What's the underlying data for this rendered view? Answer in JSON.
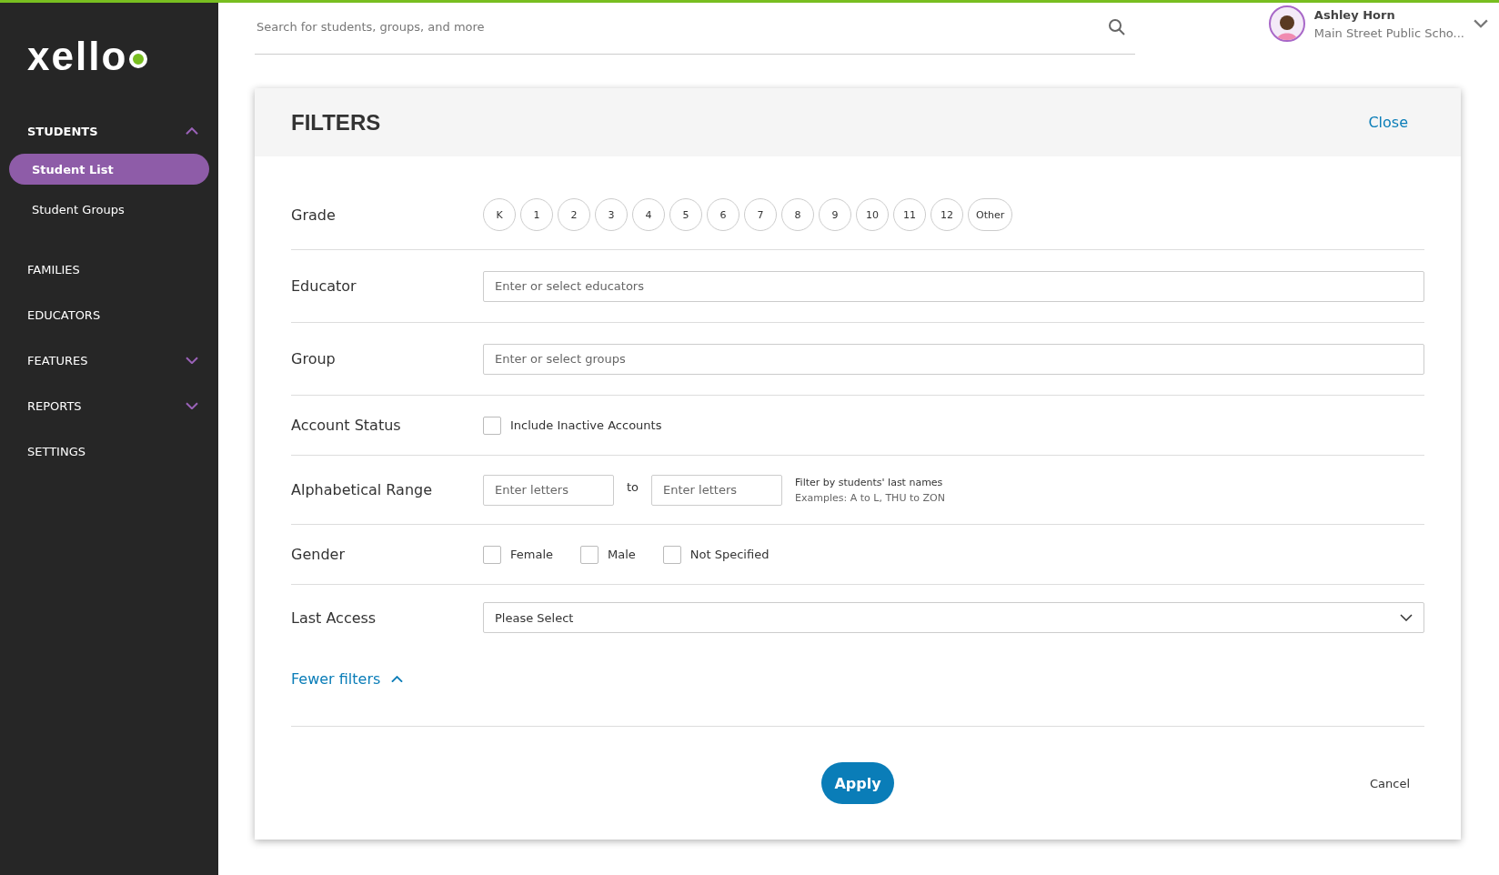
{
  "sidebar": {
    "logo": "xello",
    "items": [
      {
        "label": "STUDENTS",
        "expanded": true,
        "children": [
          {
            "label": "Student List",
            "selected": true
          },
          {
            "label": "Student Groups",
            "selected": false
          }
        ]
      },
      {
        "label": "FAMILIES"
      },
      {
        "label": "EDUCATORS"
      },
      {
        "label": "FEATURES",
        "expanded": false
      },
      {
        "label": "REPORTS",
        "expanded": false
      },
      {
        "label": "SETTINGS"
      }
    ]
  },
  "search": {
    "placeholder": "Search for students, groups, and more"
  },
  "user": {
    "name": "Ashley Horn",
    "school": "Main Street Public Scho..."
  },
  "filters": {
    "title": "FILTERS",
    "close": "Close",
    "grade": {
      "label": "Grade",
      "options": [
        {
          "label": "K",
          "selected": false
        },
        {
          "label": "1",
          "selected": false
        },
        {
          "label": "2",
          "selected": false
        },
        {
          "label": "3",
          "selected": false
        },
        {
          "label": "4",
          "selected": false
        },
        {
          "label": "5",
          "selected": false
        },
        {
          "label": "6",
          "selected": false
        },
        {
          "label": "7",
          "selected": false
        },
        {
          "label": "8",
          "selected": false
        },
        {
          "label": "9",
          "selected": false
        },
        {
          "label": "10",
          "selected": false
        },
        {
          "label": "11",
          "selected": false
        },
        {
          "label": "12",
          "selected": false
        },
        {
          "label": "Other",
          "selected": false
        }
      ]
    },
    "educator": {
      "label": "Educator",
      "placeholder": "Enter or select educators"
    },
    "group": {
      "label": "Group",
      "placeholder": "Enter or select groups"
    },
    "account_status": {
      "label": "Account Status",
      "options": [
        {
          "label": "Include Inactive Accounts",
          "checked": false
        }
      ]
    },
    "alphabetical_range": {
      "label": "Alphabetical Range",
      "from_placeholder": "Enter letters",
      "to": "to",
      "to_placeholder": "Enter letters",
      "hint": "Filter by students' last names",
      "examples": "Examples: A to L, THU to ZON"
    },
    "gender": {
      "label": "Gender",
      "options": [
        {
          "label": "Female",
          "checked": false
        },
        {
          "label": "Male",
          "checked": false
        },
        {
          "label": "Not Specified",
          "checked": false
        }
      ]
    },
    "last_access": {
      "label": "Last Access",
      "value": "Please Select"
    },
    "fewer_filters": "Fewer filters",
    "apply": "Apply",
    "cancel": "Cancel"
  }
}
